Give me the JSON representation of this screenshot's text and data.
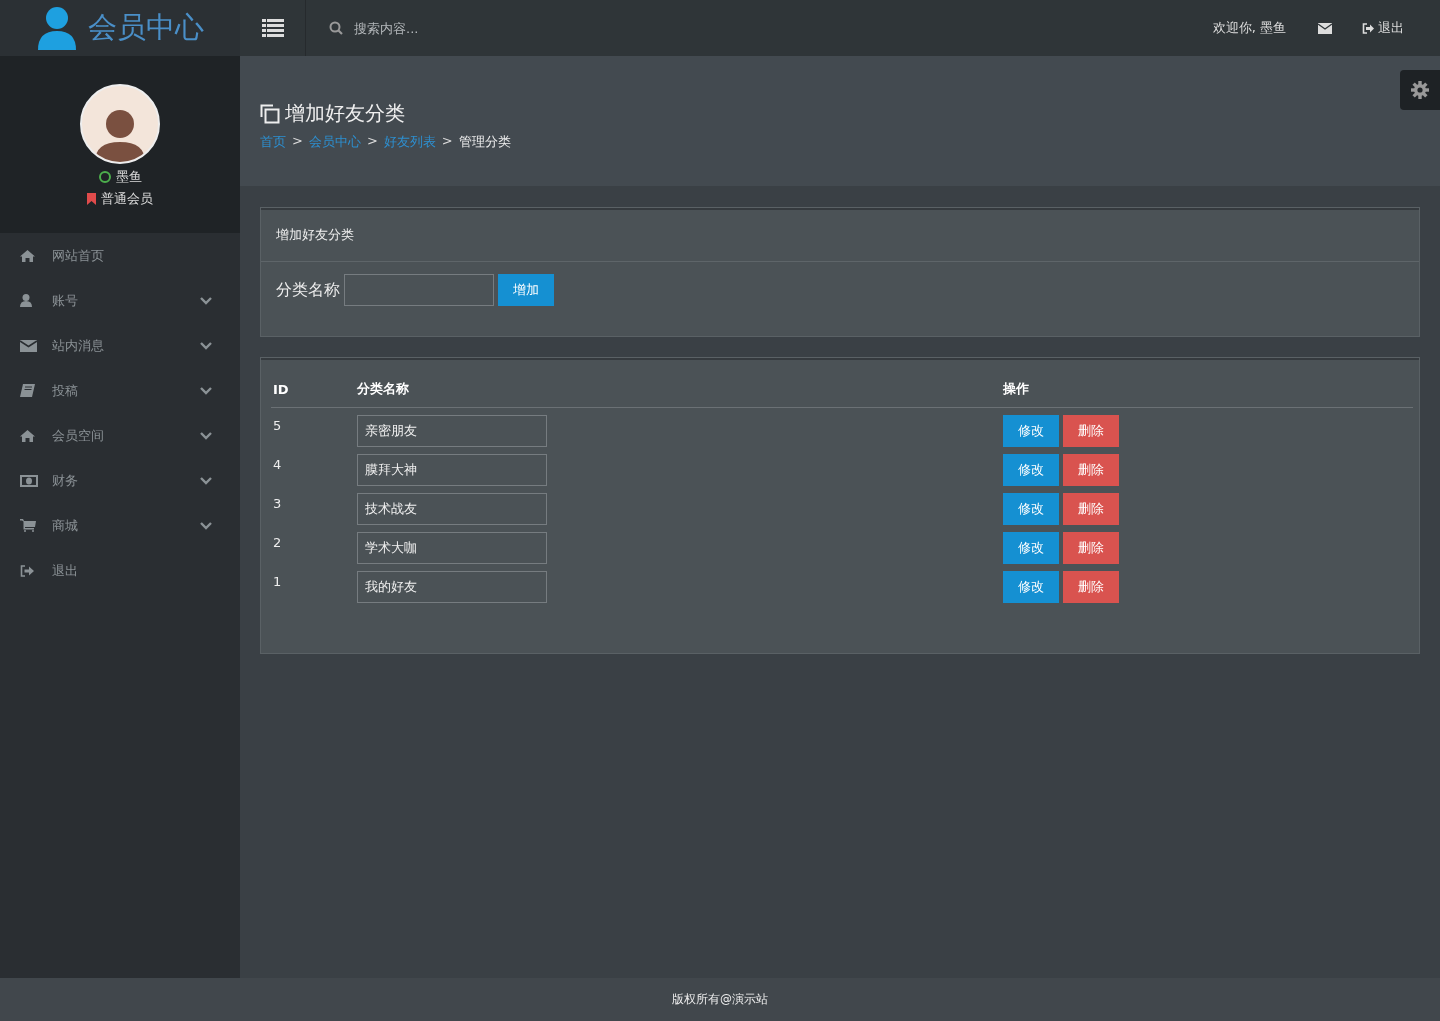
{
  "logo": {
    "title": "会员中心"
  },
  "topbar": {
    "search": {
      "placeholder": "搜索内容..."
    },
    "welcome": "欢迎你, 墨鱼",
    "logout": "退出"
  },
  "user": {
    "name": "墨鱼",
    "online": true,
    "level": "普通会员"
  },
  "sidebar": {
    "items": [
      {
        "label": "网站首页",
        "has_children": false
      },
      {
        "label": "账号",
        "has_children": true
      },
      {
        "label": "站内消息",
        "has_children": true
      },
      {
        "label": "投稿",
        "has_children": true
      },
      {
        "label": "会员空间",
        "has_children": true
      },
      {
        "label": "财务",
        "has_children": true
      },
      {
        "label": "商城",
        "has_children": true
      },
      {
        "label": "退出",
        "has_children": false
      }
    ]
  },
  "page": {
    "title": "增加好友分类",
    "breadcrumb_separator": ">",
    "breadcrumb": [
      {
        "label": "首页",
        "link": true
      },
      {
        "label": "会员中心",
        "link": true
      },
      {
        "label": "好友列表",
        "link": true
      },
      {
        "label": "管理分类",
        "link": false
      }
    ]
  },
  "add_form": {
    "title": "增加好友分类",
    "label": "分类名称",
    "button": "增加"
  },
  "table": {
    "columns": [
      "ID",
      "分类名称",
      "操作"
    ],
    "rows": [
      {
        "id": "5",
        "name": "亲密朋友",
        "edit": "修改",
        "delete": "删除"
      },
      {
        "id": "4",
        "name": "膜拜大神",
        "edit": "修改",
        "delete": "删除"
      },
      {
        "id": "3",
        "name": "技术战友",
        "edit": "修改",
        "delete": "删除"
      },
      {
        "id": "2",
        "name": "学术大咖",
        "edit": "修改",
        "delete": "删除"
      },
      {
        "id": "1",
        "name": "我的好友",
        "edit": "修改",
        "delete": "删除"
      }
    ]
  },
  "footer": "版权所有@演示站"
}
